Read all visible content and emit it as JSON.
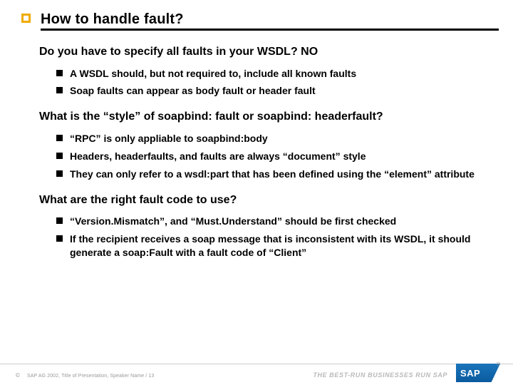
{
  "slide": {
    "title": "How to handle fault?",
    "sections": [
      {
        "question": "Do you have to specify all faults in your WSDL? NO",
        "bullets": [
          "A WSDL should, but not required to, include all known faults",
          "Soap faults can appear as body fault or header fault"
        ]
      },
      {
        "question": "What is the “style” of soapbind: fault or soapbind: headerfault?",
        "bullets": [
          "“RPC” is only appliable to soapbind:body",
          "Headers, headerfaults, and faults are always “document” style",
          "They can only refer to a wsdl:part that has been defined using the “element” attribute"
        ]
      },
      {
        "question": "What are the right fault code to use?",
        "bullets": [
          "“Version.Mismatch”, and “Must.Understand” should be first checked",
          "If the recipient receives a soap message that is inconsistent with its WSDL, it should generate a soap:Fault with a fault code of “Client”"
        ]
      }
    ]
  },
  "footer": {
    "copyright_symbol": "©",
    "copyright": "SAP AG 2002, Title of Presentation, Speaker Name / 13",
    "tagline": "THE BEST-RUN BUSINESSES RUN SAP",
    "logo": "SAP",
    "registered": "®"
  }
}
